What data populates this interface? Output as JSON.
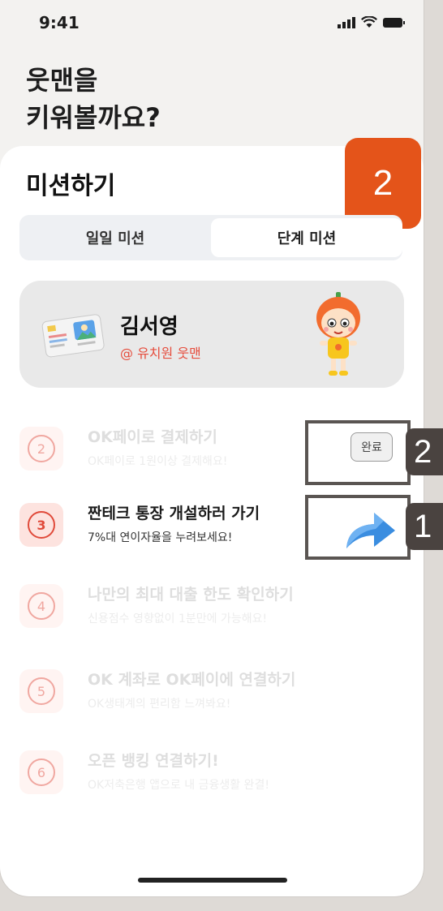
{
  "status_bar": {
    "time": "9:41"
  },
  "headline": {
    "line1": "웃맨을",
    "line2": "키워볼까요?"
  },
  "sheet": {
    "title": "미션하기",
    "step_badge": "2",
    "tabs": [
      {
        "label": "일일 미션",
        "selected": false
      },
      {
        "label": "단계 미션",
        "selected": true
      }
    ]
  },
  "profile": {
    "name": "김서영",
    "subtitle": "@ 유치원 웃맨"
  },
  "missions": [
    {
      "number": "2",
      "title": "OK페이로 결제하기",
      "subtitle": "OK페이로 1원이상 결제해요!",
      "state": "done"
    },
    {
      "number": "3",
      "title": "짠테크 통장 개설하러 가기",
      "subtitle": "7%대 연이자율을 누려보세요!",
      "state": "active"
    },
    {
      "number": "4",
      "title": "나만의 최대 대출 한도 확인하기",
      "subtitle": "신용점수 영향없이 1분만에 가능해요!",
      "state": "locked"
    },
    {
      "number": "5",
      "title": "OK 계좌로 OK페이에 연결하기",
      "subtitle": "OK생태계의 편리함 느껴봐요!",
      "state": "locked"
    },
    {
      "number": "6",
      "title": "오픈 뱅킹 연결하기!",
      "subtitle": "OK저축은행 앱으로 내 금융생활 완결!",
      "state": "locked"
    }
  ],
  "done_badge": "완료",
  "annotations": {
    "tag_done": "2",
    "tag_go": "1"
  },
  "colors": {
    "accent": "#e4541a",
    "active": "#e04a3a",
    "arrow": "#3a8de0"
  }
}
